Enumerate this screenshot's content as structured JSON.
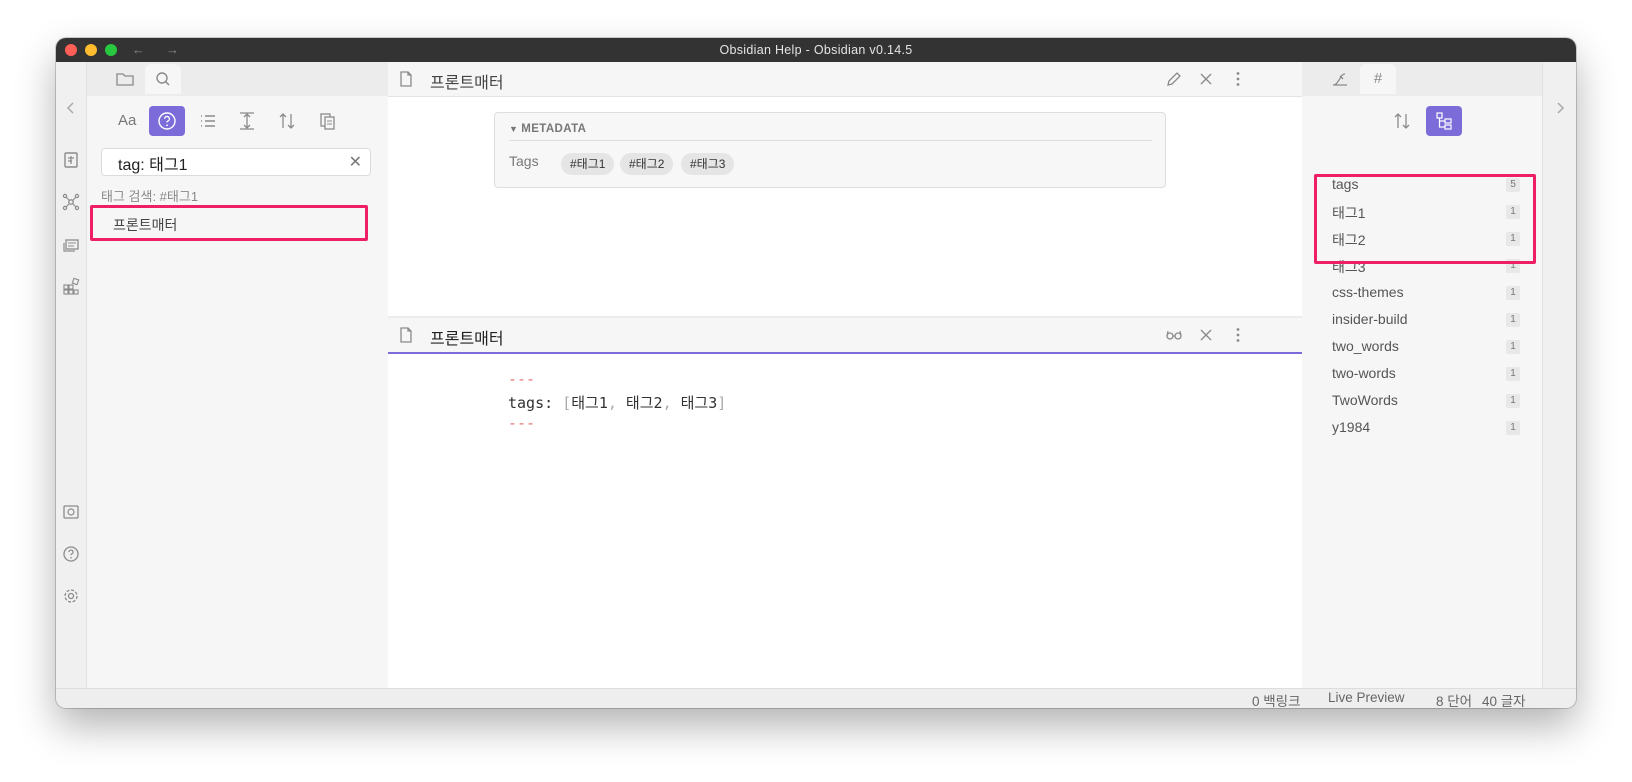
{
  "window": {
    "title": "Obsidian Help - Obsidian v0.14.5"
  },
  "left_sidebar": {
    "tabs": [
      {
        "icon": "folder-icon"
      },
      {
        "icon": "search-icon",
        "active": true
      }
    ],
    "toolbar": [
      {
        "label": "Aa",
        "icon": "match-case-icon"
      },
      {
        "icon": "help-icon",
        "active": true
      },
      {
        "icon": "list-icon"
      },
      {
        "icon": "collapse-icon"
      },
      {
        "icon": "sort-icon"
      },
      {
        "icon": "copy-icon"
      }
    ],
    "search": {
      "value": "tag: 태그1",
      "clear_label": "✕"
    },
    "result_summary": "태그 검색: #태그1",
    "results": [
      {
        "file": "프론트매터"
      }
    ]
  },
  "editor_top": {
    "title": "프론트매터",
    "metadata": {
      "heading": "METADATA",
      "key": "Tags",
      "tags": [
        "#태그1",
        "#태그2",
        "#태그3"
      ]
    }
  },
  "editor_bottom": {
    "title": "프론트매터",
    "frontmatter": {
      "delimiter": "---",
      "key": "tags",
      "colon": ":",
      "values": [
        "태그1",
        "태그2",
        "태그3"
      ]
    }
  },
  "right_sidebar": {
    "tabs": [
      {
        "icon": "outline-icon"
      },
      {
        "label": "#",
        "icon": "tag-icon",
        "active": true
      }
    ],
    "tags": [
      {
        "name": "tags",
        "count": "5"
      },
      {
        "name": "태그1",
        "count": "1"
      },
      {
        "name": "태그2",
        "count": "1"
      },
      {
        "name": "태그3",
        "count": "1"
      },
      {
        "name": "css-themes",
        "count": "1"
      },
      {
        "name": "insider-build",
        "count": "1"
      },
      {
        "name": "two_words",
        "count": "1"
      },
      {
        "name": "two-words",
        "count": "1"
      },
      {
        "name": "TwoWords",
        "count": "1"
      },
      {
        "name": "y1984",
        "count": "1"
      }
    ]
  },
  "status_bar": {
    "backlinks": "0 백링크",
    "mode": "Live Preview",
    "words": "8 단어",
    "chars": "40 글자"
  },
  "colors": {
    "accent": "#7b6cd9",
    "highlight": "#ee1f64",
    "yaml_delimiter": "#e57373"
  }
}
